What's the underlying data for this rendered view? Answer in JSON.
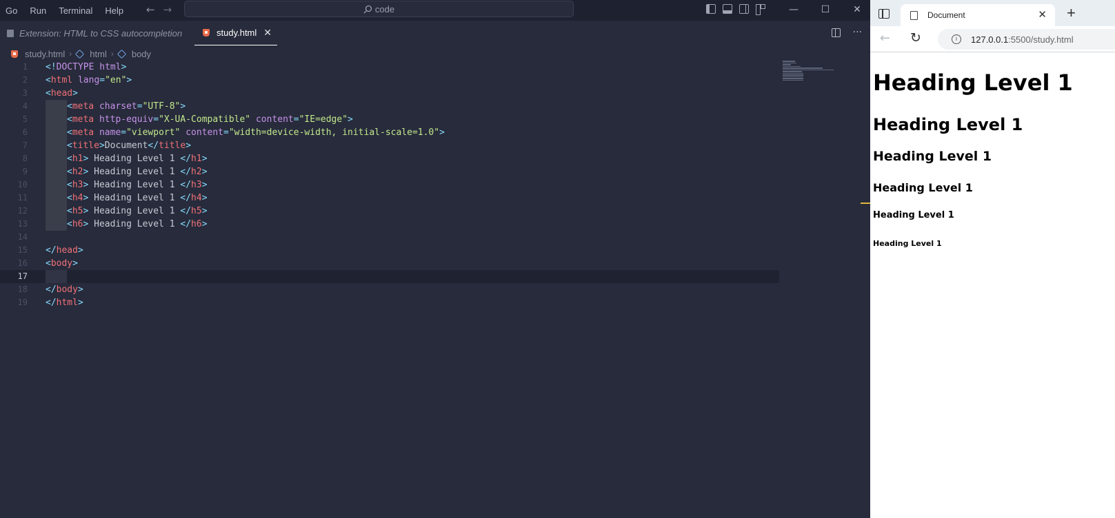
{
  "editor": {
    "menu": [
      "Go",
      "Run",
      "Terminal",
      "Help"
    ],
    "command_center": "code",
    "tabs": [
      {
        "label": "Extension: HTML to CSS autocompletion",
        "active": false
      },
      {
        "label": "study.html",
        "active": true
      }
    ],
    "breadcrumb": [
      "study.html",
      "html",
      "body"
    ],
    "current_line": 17,
    "lines": [
      {
        "n": 1,
        "code": "<!DOCTYPE html>"
      },
      {
        "n": 2,
        "code": "<html lang=\"en\">"
      },
      {
        "n": 3,
        "code": "<head>"
      },
      {
        "n": 4,
        "code": "<meta charset=\"UTF-8\">"
      },
      {
        "n": 5,
        "code": "<meta http-equiv=\"X-UA-Compatible\" content=\"IE=edge\">"
      },
      {
        "n": 6,
        "code": "<meta name=\"viewport\" content=\"width=device-width, initial-scale=1.0\">"
      },
      {
        "n": 7,
        "code": "<title>Document</title>"
      },
      {
        "n": 8,
        "code": "<h1> Heading Level 1 </h1>"
      },
      {
        "n": 9,
        "code": "<h2> Heading Level 1 </h2>"
      },
      {
        "n": 10,
        "code": "<h3> Heading Level 1 </h3>"
      },
      {
        "n": 11,
        "code": "<h4> Heading Level 1 </h4>"
      },
      {
        "n": 12,
        "code": "<h5> Heading Level 1 </h5>"
      },
      {
        "n": 13,
        "code": "<h6> Heading Level 1 </h6>"
      },
      {
        "n": 14,
        "code": ""
      },
      {
        "n": 15,
        "code": "</head>"
      },
      {
        "n": 16,
        "code": "<body>"
      },
      {
        "n": 17,
        "code": ""
      },
      {
        "n": 18,
        "code": "</body>"
      },
      {
        "n": 19,
        "code": "</html>"
      }
    ]
  },
  "browser": {
    "tab_title": "Document",
    "url_host": "127.0.0.1",
    "url_rest": ":5500/study.html",
    "headings": {
      "h1": "Heading Level 1",
      "h2": "Heading Level 1",
      "h3": "Heading Level 1",
      "h4": "Heading Level 1",
      "h5": "Heading Level 1",
      "h6": "Heading Level 1"
    }
  },
  "colors": {
    "editor_bg": "#272b3b",
    "tag": "#f07178",
    "attr": "#c792ea",
    "string": "#c3e88d",
    "bracket": "#89ddff"
  }
}
